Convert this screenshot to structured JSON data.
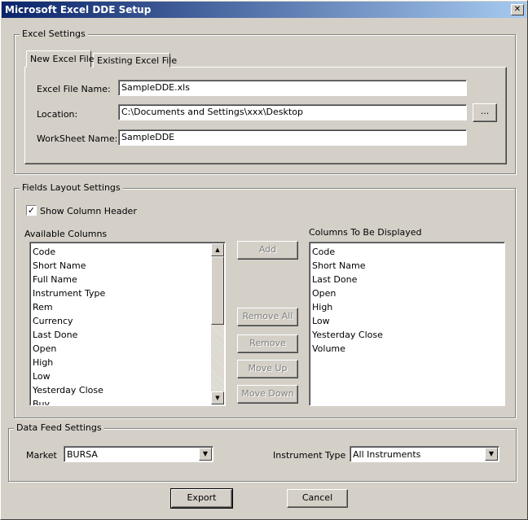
{
  "window": {
    "title": "Microsoft Excel DDE Setup",
    "close_symbol": "✕"
  },
  "excel_settings": {
    "legend": "Excel Settings",
    "tabs": [
      {
        "label": "New Excel File",
        "active": true
      },
      {
        "label": "Existing Excel File",
        "active": false
      }
    ],
    "file_name_label": "Excel File Name:",
    "file_name_value": "SampleDDE.xls",
    "location_label": "Location:",
    "location_value": "C:\\Documents and Settings\\xxx\\Desktop",
    "browse_label": "...",
    "worksheet_label": "WorkSheet Name:",
    "worksheet_value": "SampleDDE"
  },
  "fields_layout": {
    "legend": "Fields Layout Settings",
    "show_header_label": "Show Column Header",
    "show_header_checked": true,
    "check_symbol": "✓",
    "available_label": "Available Columns",
    "available_items": [
      "Code",
      "Short Name",
      "Full Name",
      "Instrument Type",
      "Rem",
      "Currency",
      "Last Done",
      "Open",
      "High",
      "Low",
      "Yesterday Close",
      "Buy"
    ],
    "displayed_label": "Columns To Be Displayed",
    "displayed_items": [
      "Code",
      "Short Name",
      "Last Done",
      "Open",
      "High",
      "Low",
      "Yesterday Close",
      "Volume"
    ],
    "buttons": {
      "add": "Add",
      "remove_all": "Remove All",
      "remove": "Remove",
      "move_up": "Move Up",
      "move_down": "Move Down"
    },
    "scroll_up_symbol": "▲",
    "scroll_down_symbol": "▼"
  },
  "data_feed": {
    "legend": "Data Feed Settings",
    "market_label": "Market",
    "market_value": "BURSA",
    "instrument_type_label": "Instrument Type",
    "instrument_type_value": "All Instruments",
    "dropdown_symbol": "▼"
  },
  "footer": {
    "export_label": "Export",
    "cancel_label": "Cancel"
  }
}
